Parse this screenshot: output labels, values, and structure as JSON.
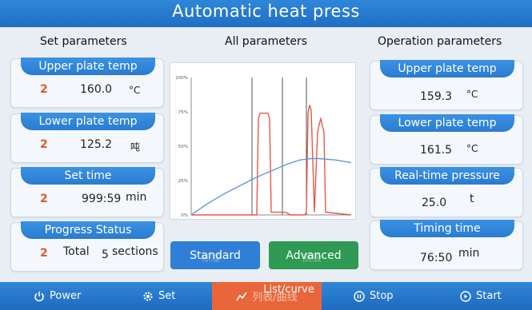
{
  "header": {
    "title": "Automatic heat press"
  },
  "columns": {
    "left": "Set parameters",
    "middle": "All parameters",
    "right": "Operation parameters"
  },
  "left_panels": [
    {
      "label": "Upper plate temp",
      "index": "2",
      "value": "160.0",
      "unit": "°C"
    },
    {
      "label": "Lower plate temp",
      "index": "2",
      "value": "125.2",
      "unit": "吨"
    },
    {
      "label": "Set time",
      "index": "2",
      "value": "999:59",
      "unit": "min"
    },
    {
      "label": "Progress Status",
      "index": "2",
      "value": "Total",
      "extra": "5",
      "unit": "sections"
    }
  ],
  "right_panels": [
    {
      "label": "Upper plate temp",
      "value": "159.3",
      "unit": "°C"
    },
    {
      "label": "Lower plate temp",
      "value": "161.5",
      "unit": "°C"
    },
    {
      "label": "Real-time pressure",
      "value": "25.0",
      "unit": "t"
    },
    {
      "label": "Timing time",
      "value": "76:50",
      "unit": "min"
    }
  ],
  "chart_data": {
    "type": "line",
    "y_tick_labels": [
      "100%",
      "75%",
      "50%",
      "25%",
      "0%"
    ],
    "ylim": [
      0,
      100
    ],
    "xlim": [
      0,
      100
    ],
    "grid": false,
    "markers_x": [
      38,
      57,
      72
    ],
    "series": [
      {
        "color": "#e8574a",
        "x": [
          0,
          41,
          42,
          43,
          48,
          49,
          50,
          59,
          62,
          64,
          71,
          72,
          73,
          74,
          75,
          77,
          79,
          80,
          81,
          83,
          84,
          100
        ],
        "y": [
          0,
          0,
          70,
          74,
          74,
          70,
          2,
          2,
          0,
          0,
          0,
          2,
          74,
          80,
          76,
          2,
          60,
          66,
          70,
          60,
          2,
          0
        ]
      },
      {
        "color": "#5b9be0",
        "x": [
          0,
          10,
          20,
          30,
          40,
          50,
          60,
          68,
          75,
          80,
          90,
          100
        ],
        "y": [
          0,
          8,
          15,
          21,
          27,
          32,
          37,
          40,
          41,
          41,
          40,
          38
        ]
      }
    ]
  },
  "mode_buttons": {
    "standard": "Standard",
    "standard_cn": "标准",
    "advanced": "Advanced",
    "advanced_cn": "高级"
  },
  "footer": {
    "power": "Power",
    "set": "Set",
    "list_curve": "List/curve",
    "list_curve_cn": "列表/曲线",
    "stop": "Stop",
    "start": "Start"
  },
  "colors": {
    "accent": "#2a7bd0",
    "active": "#e8663a",
    "standard_btn": "#2f7fd6",
    "advanced_btn": "#2e9a54"
  }
}
